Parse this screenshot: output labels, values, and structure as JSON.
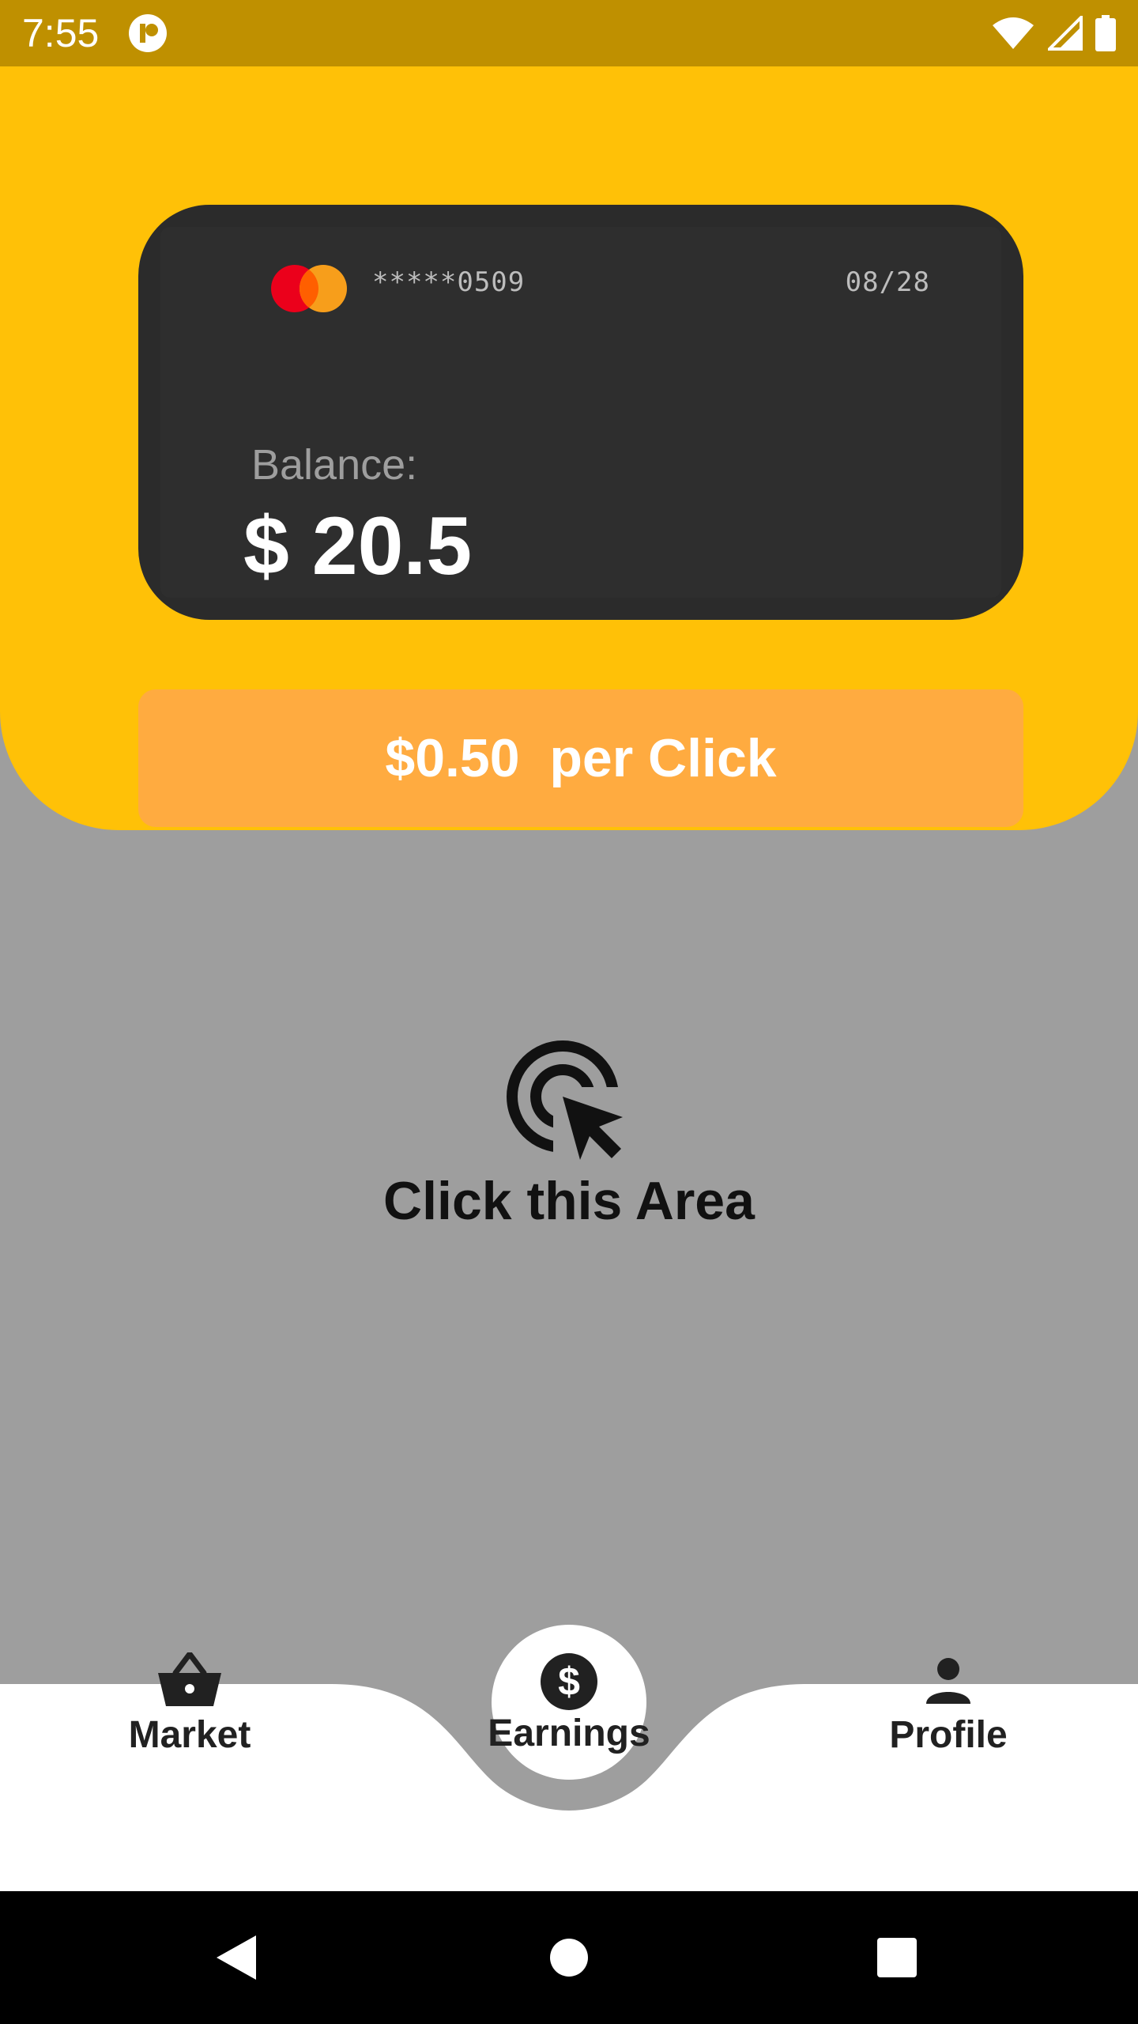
{
  "status_bar": {
    "time": "7:55",
    "icons": [
      "notification-icon",
      "wifi-icon",
      "signal-icon",
      "battery-icon"
    ]
  },
  "card": {
    "brand": "MasterCard",
    "number": "*****0509",
    "expiry": "08/28",
    "balance_label": "Balance:",
    "balance_value": "$ 20.5"
  },
  "rate_button": {
    "label": "$0.50  per Click"
  },
  "click_area": {
    "icon": "cursor-click-icon",
    "label": "Click this Area"
  },
  "bottom_nav": {
    "items": [
      {
        "label": "Market",
        "icon": "basket-icon"
      },
      {
        "label": "Earnings",
        "icon": "dollar-icon",
        "selected": true
      },
      {
        "label": "Profile",
        "icon": "person-icon"
      }
    ]
  },
  "system_nav": {
    "icons": [
      "back-icon",
      "home-icon",
      "recents-icon"
    ]
  },
  "colors": {
    "status_bar": "#BF9000",
    "header": "#FFC107",
    "card": "#2B2B2B",
    "rate_button": "#FFAB40",
    "background": "#9E9E9E",
    "nav_bar": "#FFFFFF",
    "system_nav": "#000000"
  }
}
